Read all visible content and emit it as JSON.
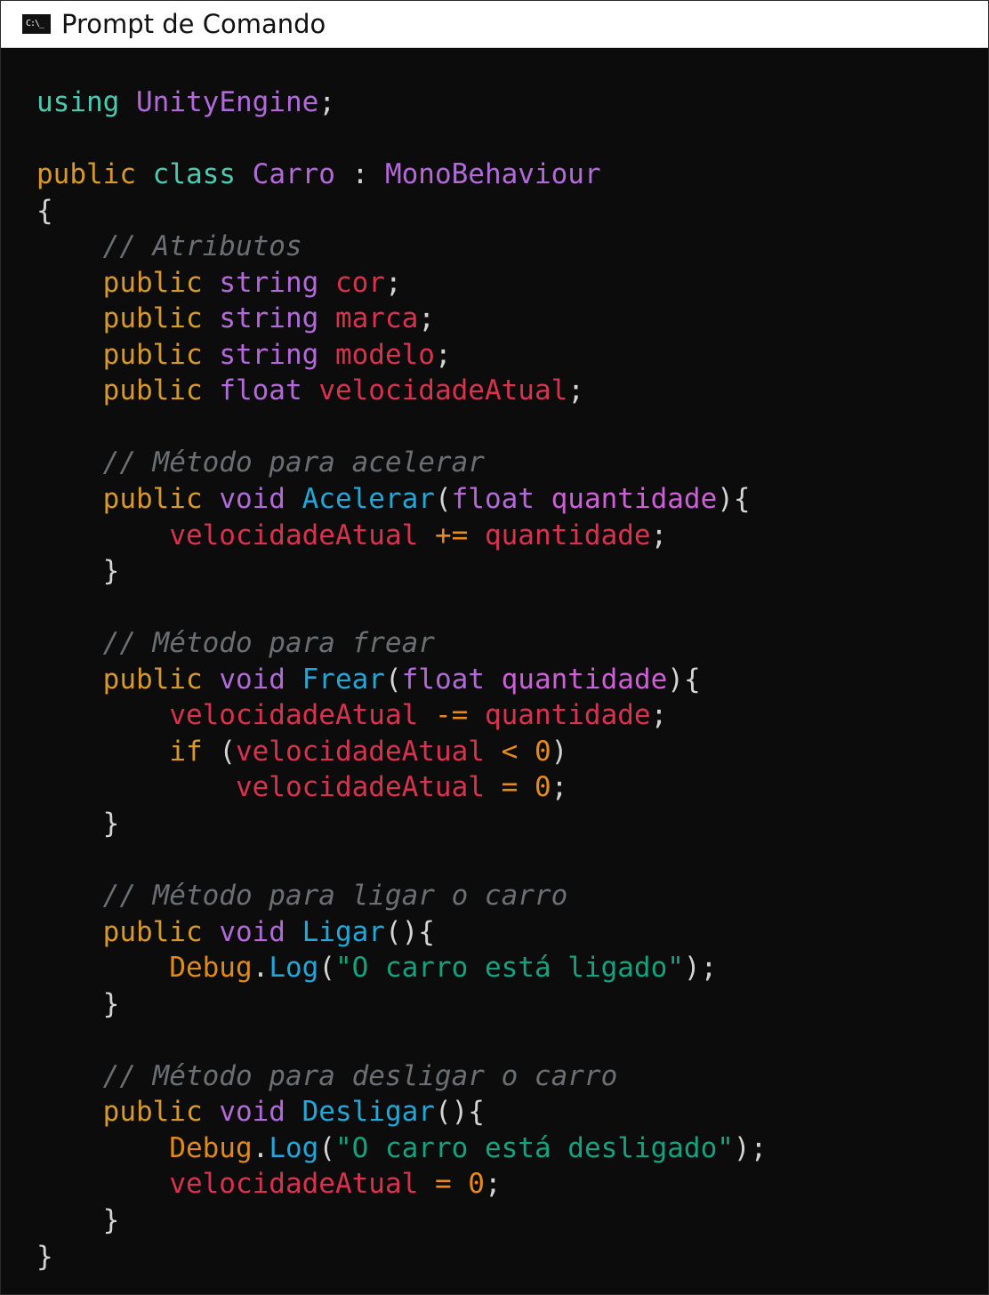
{
  "window": {
    "title": "Prompt de Comando",
    "icon": "cmd-icon",
    "icon_glyph": "C:\\_"
  },
  "code": {
    "l1": [
      "using",
      "UnityEngine",
      ";"
    ],
    "l3": [
      "public",
      "class",
      "Carro",
      " : ",
      "MonoBehaviour"
    ],
    "l4": [
      "{"
    ],
    "l5": [
      "// Atributos"
    ],
    "l6": [
      "public",
      "string",
      "cor",
      ";"
    ],
    "l7": [
      "public",
      "string",
      "marca",
      ";"
    ],
    "l8": [
      "public",
      "string",
      "modelo",
      ";"
    ],
    "l9": [
      "public",
      "float",
      "velocidadeAtual",
      ";"
    ],
    "l11": [
      "// Método para acelerar"
    ],
    "l12": [
      "public",
      "void",
      "Acelerar",
      "(",
      "float",
      "quantidade",
      "){"
    ],
    "l13": [
      "velocidadeAtual",
      "+=",
      "quantidade",
      ";"
    ],
    "l14": [
      "}"
    ],
    "l16": [
      "// Método para frear"
    ],
    "l17": [
      "public",
      "void",
      "Frear",
      "(",
      "float",
      "quantidade",
      "){"
    ],
    "l18": [
      "velocidadeAtual",
      "-=",
      "quantidade",
      ";"
    ],
    "l19": [
      "if",
      "(",
      "velocidadeAtual",
      "<",
      "0",
      ")"
    ],
    "l20": [
      "velocidadeAtual",
      "=",
      "0",
      ";"
    ],
    "l21": [
      "}"
    ],
    "l23": [
      "// Método para ligar o carro"
    ],
    "l24": [
      "public",
      "void",
      "Ligar",
      "(){"
    ],
    "l25": [
      "Debug",
      ".",
      "Log",
      "(",
      "\"O carro está ligado\"",
      ");"
    ],
    "l26": [
      "}"
    ],
    "l28": [
      "// Método para desligar o carro"
    ],
    "l29": [
      "public",
      "void",
      "Desligar",
      "(){"
    ],
    "l30": [
      "Debug",
      ".",
      "Log",
      "(",
      "\"O carro está desligado\"",
      ");"
    ],
    "l31": [
      "velocidadeAtual",
      "=",
      "0",
      ";"
    ],
    "l32": [
      "}"
    ],
    "l33": [
      "}"
    ]
  }
}
